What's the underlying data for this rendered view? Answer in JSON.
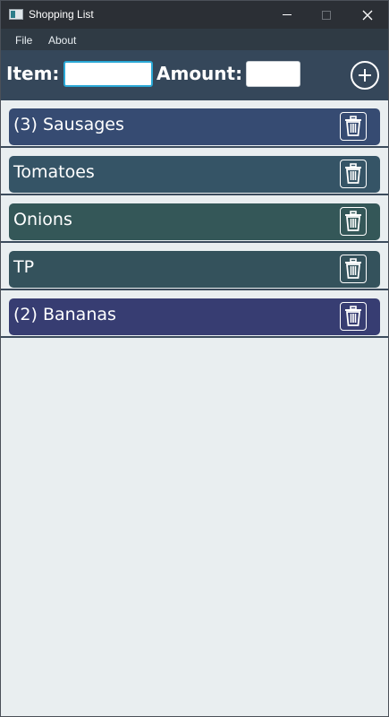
{
  "window": {
    "title": "Shopping List"
  },
  "menu": {
    "file": "File",
    "about": "About"
  },
  "form": {
    "item_label": "Item:",
    "item_value": "",
    "amount_label": "Amount:",
    "amount_value": ""
  },
  "items": [
    {
      "label": "(3) Sausages",
      "color": "#364b72"
    },
    {
      "label": "Tomatoes",
      "color": "#355466"
    },
    {
      "label": "Onions",
      "color": "#345758"
    },
    {
      "label": "TP",
      "color": "#34525c"
    },
    {
      "label": "(2) Bananas",
      "color": "#373d72"
    }
  ],
  "icons": {
    "add": "plus-circle-icon",
    "delete": "trash-icon"
  },
  "colors": {
    "titlebar": "#2b2f35",
    "menubar": "#2f3a44",
    "inputbar": "#35475a",
    "background": "#e9eef0",
    "focus": "#2aa8d6"
  }
}
